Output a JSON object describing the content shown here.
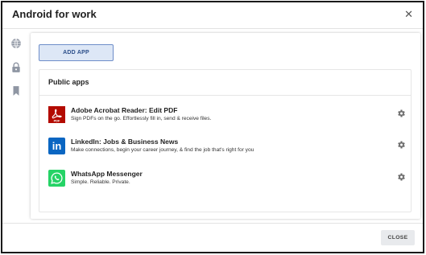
{
  "dialog": {
    "title": "Android for work",
    "close_icon": "close-icon"
  },
  "sidebar": {
    "icons": [
      "globe-icon",
      "lock-icon",
      "bookmark-icon"
    ]
  },
  "toolbar": {
    "add_app_label": "ADD APP"
  },
  "public_apps": {
    "title": "Public apps",
    "apps": [
      {
        "name": "Adobe Acrobat Reader: Edit PDF",
        "description": "Sign PDFs on the go. Effortlessly fill in, send & receive files.",
        "icon": "adobe-acrobat-icon",
        "icon_label": "PDF",
        "color": "#b30b00"
      },
      {
        "name": "LinkedIn: Jobs & Business News",
        "description": "Make connections, begin your career journey, & find the job that's right for you",
        "icon": "linkedin-icon",
        "icon_label": "in",
        "color": "#0a66c2"
      },
      {
        "name": "WhatsApp Messenger",
        "description": "Simple. Reliable. Private.",
        "icon": "whatsapp-icon",
        "color": "#25d366"
      }
    ]
  },
  "footer": {
    "close_label": "CLOSE"
  }
}
